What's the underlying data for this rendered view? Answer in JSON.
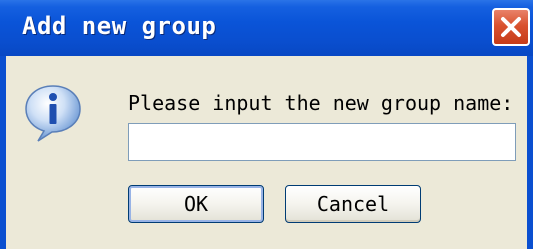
{
  "window": {
    "title": "Add new group",
    "close_icon": "close-icon"
  },
  "body": {
    "icon": "info-icon",
    "prompt": "Please input the new group name:",
    "input_value": "",
    "input_placeholder": ""
  },
  "buttons": {
    "ok_label": "OK",
    "cancel_label": "Cancel"
  },
  "colors": {
    "titlebar": "#0a54d8",
    "close_button": "#d9522f",
    "dialog_background": "#ece9d8"
  }
}
